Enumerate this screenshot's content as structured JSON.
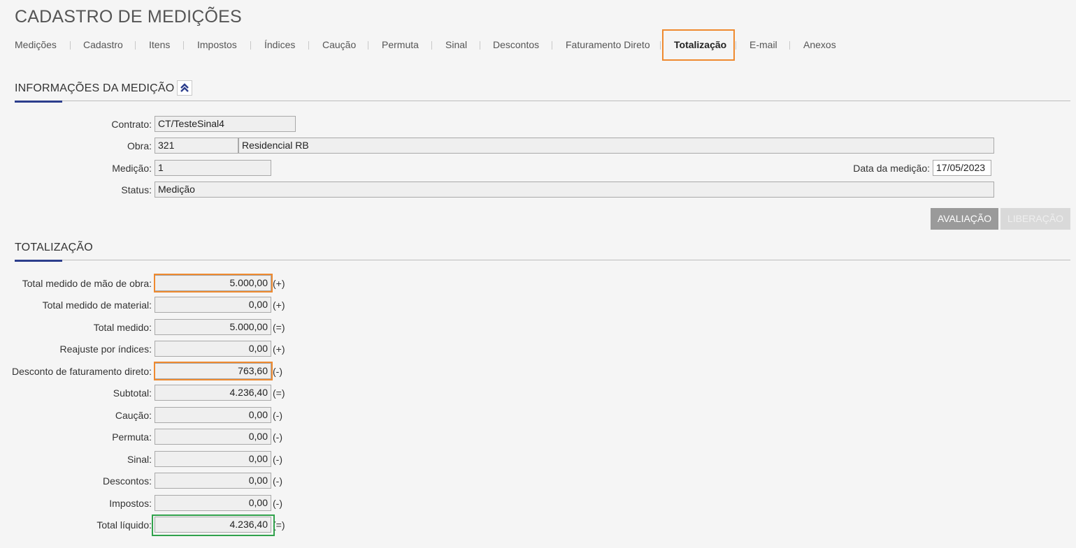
{
  "page_title": "CADASTRO DE MEDIÇÕES",
  "tabs": [
    {
      "label": "Medições"
    },
    {
      "label": "Cadastro"
    },
    {
      "label": "Itens"
    },
    {
      "label": "Impostos"
    },
    {
      "label": "Índices"
    },
    {
      "label": "Caução"
    },
    {
      "label": "Permuta"
    },
    {
      "label": "Sinal"
    },
    {
      "label": "Descontos"
    },
    {
      "label": "Faturamento Direto"
    },
    {
      "label": "Totalização"
    },
    {
      "label": "E-mail"
    },
    {
      "label": "Anexos"
    }
  ],
  "active_tab": "Totalização",
  "info_section": {
    "title": "INFORMAÇÕES DA MEDIÇÃO",
    "collapse_icon": "double-chevron-up-icon",
    "contrato_label": "Contrato:",
    "contrato_value": "CT/TesteSinal4",
    "obra_label": "Obra:",
    "obra_code": "321",
    "obra_name": "Residencial RB",
    "medicao_label": "Medição:",
    "medicao_value": "1",
    "data_label": "Data da medição:",
    "data_value": "17/05/2023",
    "status_label": "Status:",
    "status_value": "Medição"
  },
  "buttons": {
    "avaliacao": "AVALIAÇÃO",
    "liberacao": "LIBERAÇÃO"
  },
  "totals_section": {
    "title": "TOTALIZAÇÃO",
    "rows": [
      {
        "label": "Total medido de mão de obra:",
        "value": "5.000,00",
        "sign": "(+)"
      },
      {
        "label": "Total medido de material:",
        "value": "0,00",
        "sign": "(+)"
      },
      {
        "label": "Total medido:",
        "value": "5.000,00",
        "sign": "(=)"
      },
      {
        "label": "Reajuste por índices:",
        "value": "0,00",
        "sign": "(+)"
      },
      {
        "label": "Desconto de faturamento direto:",
        "value": "763,60",
        "sign": "(-)"
      },
      {
        "label": "Subtotal:",
        "value": "4.236,40",
        "sign": "(=)"
      },
      {
        "label": "Caução:",
        "value": "0,00",
        "sign": "(-)"
      },
      {
        "label": "Permuta:",
        "value": "0,00",
        "sign": "(-)"
      },
      {
        "label": "Sinal:",
        "value": "0,00",
        "sign": "(-)"
      },
      {
        "label": "Descontos:",
        "value": "0,00",
        "sign": "(-)"
      },
      {
        "label": "Impostos:",
        "value": "0,00",
        "sign": "(-)"
      },
      {
        "label": "Total líquido:",
        "value": "4.236,40",
        "sign": "(=)"
      }
    ]
  },
  "colors": {
    "highlight_orange": "#ef8a2f",
    "highlight_green": "#31a24c",
    "section_accent": "#2c3e8c",
    "button_active": "#9a9a9a",
    "button_disabled": "#d9d9d9"
  }
}
